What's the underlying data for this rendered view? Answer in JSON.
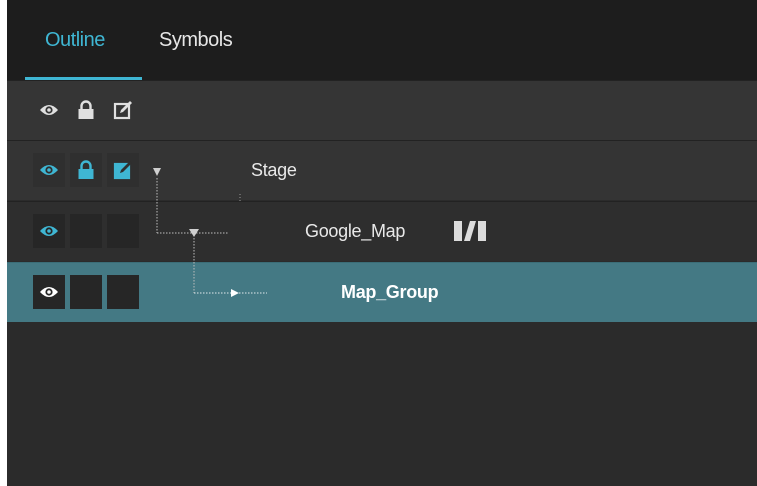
{
  "tabs": [
    {
      "label": "Outline",
      "active": true
    },
    {
      "label": "Symbols",
      "active": false
    }
  ],
  "header_row": {
    "icons": [
      "eye-icon",
      "lock-icon",
      "edit-icon"
    ]
  },
  "layers": [
    {
      "name": "Stage",
      "visible": true,
      "locked": true,
      "editable": true,
      "expanded": true
    },
    {
      "name": "Google_Map",
      "visible": true,
      "locked": false,
      "editable": false,
      "expanded": true,
      "badge_icon": "symbol-icon"
    },
    {
      "name": "Map_Group",
      "visible": true,
      "locked": false,
      "editable": false,
      "expanded": false,
      "selected": true
    }
  ],
  "colors": {
    "accent": "#3fb6d3",
    "selection": "#447984",
    "panel_background": "#2b2b2b",
    "tab_bar_background": "#1d1d1d"
  }
}
